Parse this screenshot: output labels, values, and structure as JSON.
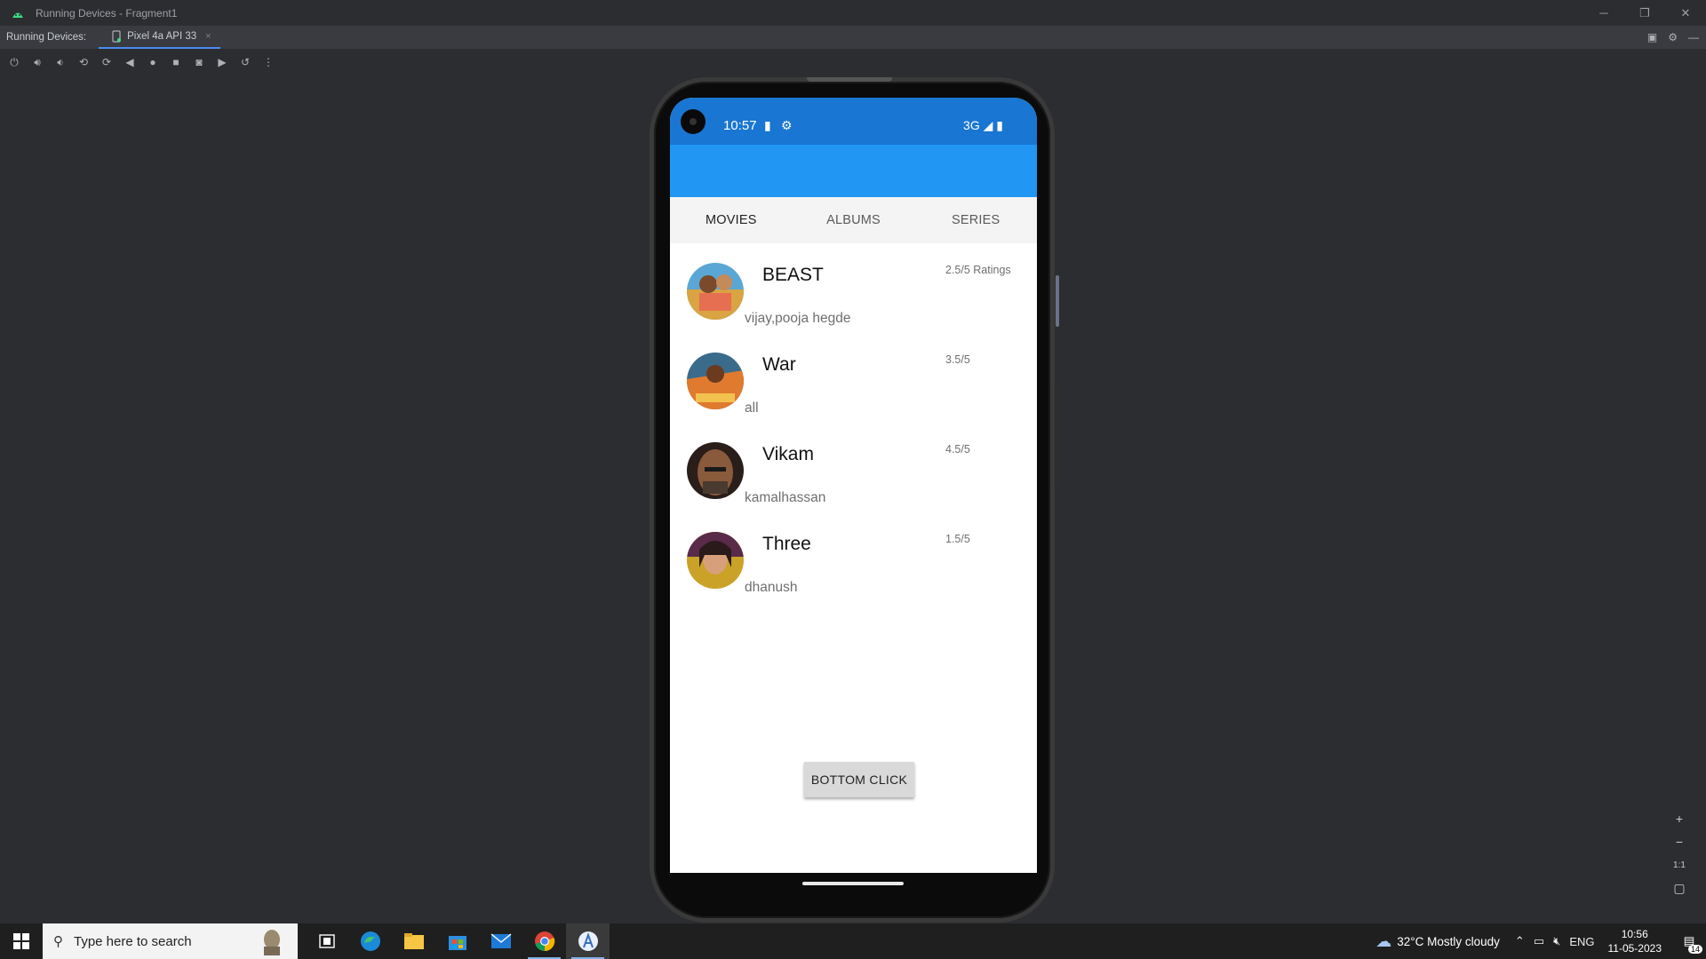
{
  "window": {
    "title": "Running Devices - Fragment1",
    "controls": {
      "minimize": "─",
      "restore": "❐",
      "close": "✕"
    }
  },
  "tabbar": {
    "label": "Running Devices:",
    "device_tab": "Pixel 4a API 33",
    "close": "×"
  },
  "phone": {
    "status": {
      "time": "10:57",
      "network": "3G"
    },
    "tabs": [
      "MOVIES",
      "ALBUMS",
      "SERIES"
    ],
    "active_tab": "MOVIES",
    "movies": [
      {
        "name": "BEAST",
        "cast": "vijay,pooja hegde",
        "rating": "2.5/5 Ratings"
      },
      {
        "name": "War",
        "cast": "all",
        "rating": "3.5/5"
      },
      {
        "name": "Vikam",
        "cast": "kamalhassan",
        "rating": "4.5/5"
      },
      {
        "name": "Three",
        "cast": "dhanush",
        "rating": "1.5/5"
      }
    ],
    "bottom_button": "BOTTOM CLICK"
  },
  "zoom": {
    "plus": "+",
    "minus": "−",
    "one_to_one": "1:1"
  },
  "taskbar": {
    "search_placeholder": "Type here to search",
    "weather": "32°C  Mostly cloudy",
    "language": "ENG",
    "time": "10:56",
    "date": "11-05-2023",
    "notifications": "14"
  },
  "colors": {
    "status_bar": "#1976d2",
    "app_bar": "#2196f3",
    "tab_underline": "#4b8bf4"
  }
}
